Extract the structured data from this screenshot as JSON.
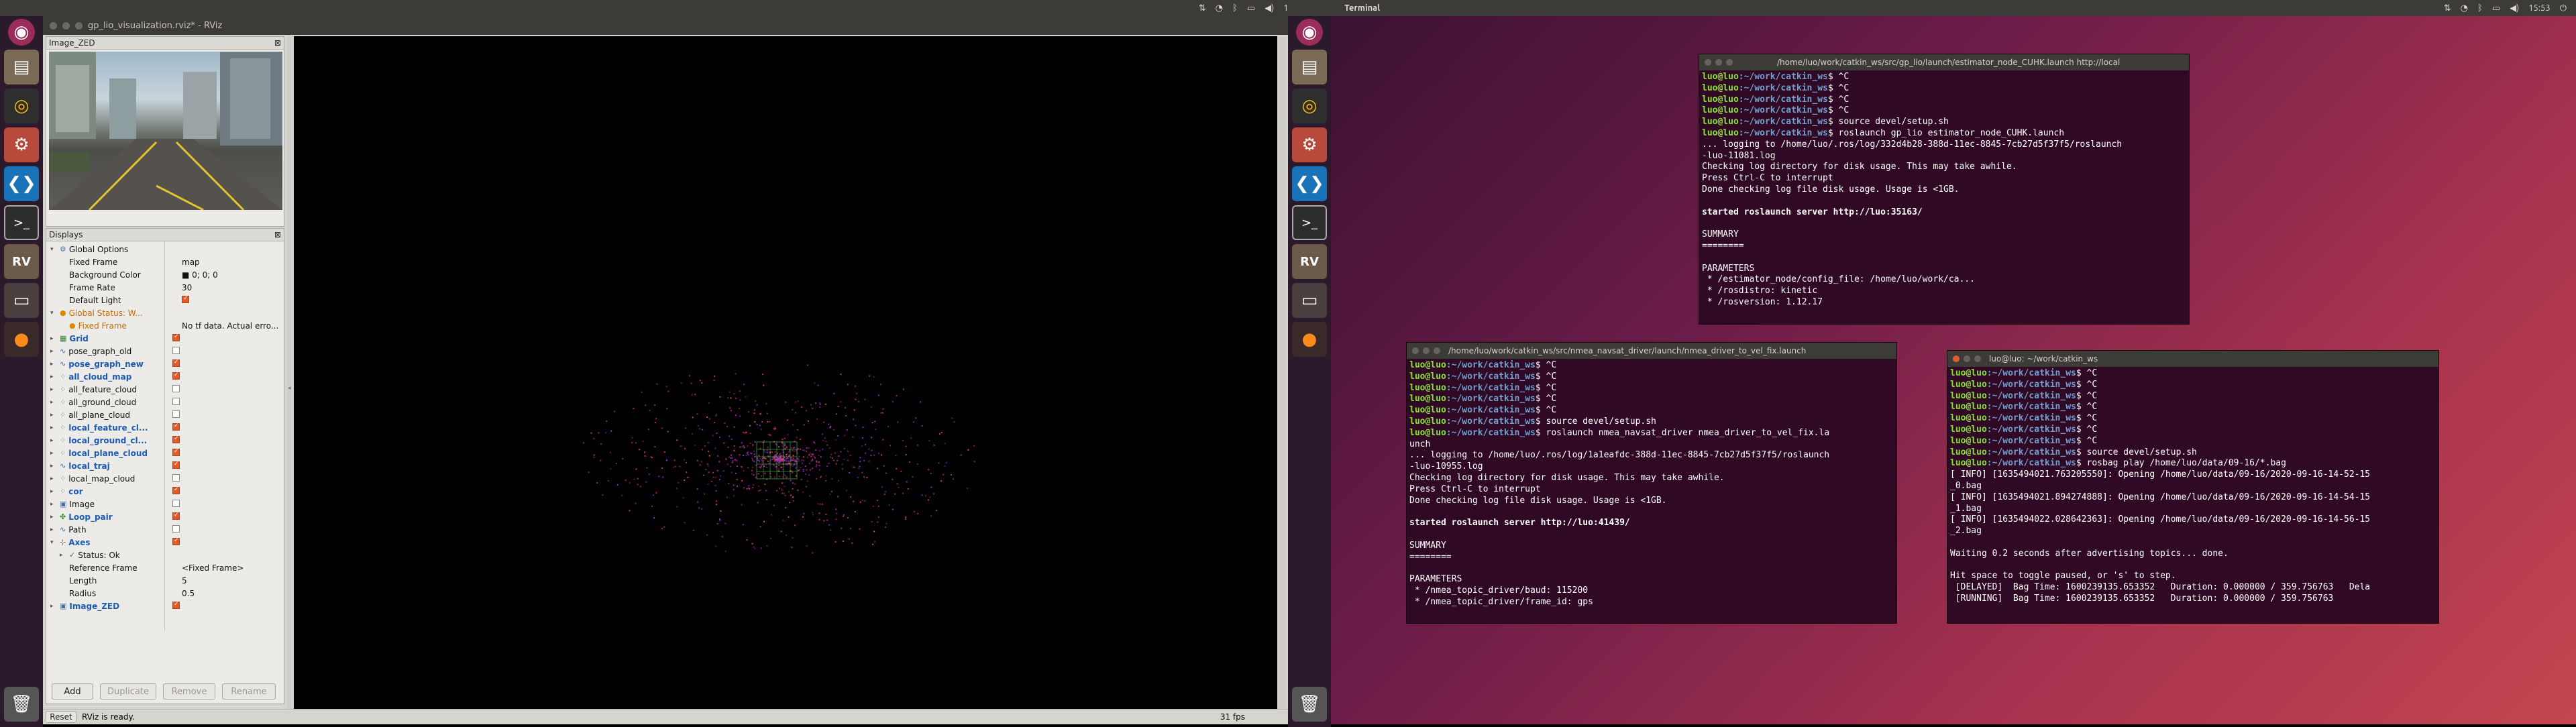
{
  "top_left": {
    "app_title": "",
    "clock": "15:53",
    "battery": "⚡",
    "tray_icons": [
      "sort-icon",
      "wifi-icon",
      "bluetooth-icon",
      "battery-icon",
      "volume-icon"
    ]
  },
  "top_right": {
    "app_title": "Terminal",
    "clock": "15:53"
  },
  "rviz": {
    "window_title": "gp_lio_visualization.rviz* - RViz",
    "image_panel_title": "Image_ZED",
    "displays_title": "Displays",
    "rows": [
      {
        "indent": 0,
        "tri": "▾",
        "icon": "gear",
        "label": "Global Options",
        "style": "",
        "value": "",
        "cb": ""
      },
      {
        "indent": 1,
        "tri": "",
        "icon": "",
        "label": "Fixed Frame",
        "style": "",
        "value": "map",
        "cb": ""
      },
      {
        "indent": 1,
        "tri": "",
        "icon": "",
        "label": "Background Color",
        "style": "",
        "value": "■ 0; 0; 0",
        "cb": ""
      },
      {
        "indent": 1,
        "tri": "",
        "icon": "",
        "label": "Frame Rate",
        "style": "",
        "value": "30",
        "cb": ""
      },
      {
        "indent": 1,
        "tri": "",
        "icon": "",
        "label": "Default Light",
        "style": "",
        "value": "",
        "cb": "on"
      },
      {
        "indent": 0,
        "tri": "▾",
        "icon": "warn",
        "label": "Global Status: W...",
        "style": "orange",
        "value": "",
        "cb": ""
      },
      {
        "indent": 1,
        "tri": "",
        "icon": "warn",
        "label": "Fixed Frame",
        "style": "orange",
        "value": "No tf data.  Actual erro...",
        "cb": ""
      },
      {
        "indent": 0,
        "tri": "▸",
        "icon": "grid",
        "label": "Grid",
        "style": "blue",
        "value": "",
        "cb": "on"
      },
      {
        "indent": 0,
        "tri": "▸",
        "icon": "path",
        "label": "pose_graph_old",
        "style": "",
        "value": "",
        "cb": "off"
      },
      {
        "indent": 0,
        "tri": "▸",
        "icon": "path",
        "label": "pose_graph_new",
        "style": "blue",
        "value": "",
        "cb": "on"
      },
      {
        "indent": 0,
        "tri": "▸",
        "icon": "cloud",
        "label": "all_cloud_map",
        "style": "blue",
        "value": "",
        "cb": "on"
      },
      {
        "indent": 0,
        "tri": "▸",
        "icon": "cloud",
        "label": "all_feature_cloud",
        "style": "",
        "value": "",
        "cb": "off"
      },
      {
        "indent": 0,
        "tri": "▸",
        "icon": "cloud",
        "label": "all_ground_cloud",
        "style": "",
        "value": "",
        "cb": "off"
      },
      {
        "indent": 0,
        "tri": "▸",
        "icon": "cloud",
        "label": "all_plane_cloud",
        "style": "",
        "value": "",
        "cb": "off"
      },
      {
        "indent": 0,
        "tri": "▸",
        "icon": "cloud",
        "label": "local_feature_cl...",
        "style": "blue",
        "value": "",
        "cb": "on"
      },
      {
        "indent": 0,
        "tri": "▸",
        "icon": "cloud",
        "label": "local_ground_cl...",
        "style": "blue",
        "value": "",
        "cb": "on"
      },
      {
        "indent": 0,
        "tri": "▸",
        "icon": "cloud",
        "label": "local_plane_cloud",
        "style": "blue",
        "value": "",
        "cb": "on"
      },
      {
        "indent": 0,
        "tri": "▸",
        "icon": "path",
        "label": "local_traj",
        "style": "blue",
        "value": "",
        "cb": "on"
      },
      {
        "indent": 0,
        "tri": "▸",
        "icon": "cloud",
        "label": "local_map_cloud",
        "style": "",
        "value": "",
        "cb": "off"
      },
      {
        "indent": 0,
        "tri": "▸",
        "icon": "cloud",
        "label": "cor",
        "style": "blue",
        "value": "",
        "cb": "on"
      },
      {
        "indent": 0,
        "tri": "▸",
        "icon": "image",
        "label": "Image",
        "style": "",
        "value": "",
        "cb": "off"
      },
      {
        "indent": 0,
        "tri": "▸",
        "icon": "marker",
        "label": "Loop_pair",
        "style": "blue",
        "value": "",
        "cb": "on"
      },
      {
        "indent": 0,
        "tri": "▸",
        "icon": "path",
        "label": "Path",
        "style": "",
        "value": "",
        "cb": "off"
      },
      {
        "indent": 0,
        "tri": "▾",
        "icon": "axes",
        "label": "Axes",
        "style": "blue",
        "value": "",
        "cb": "on"
      },
      {
        "indent": 1,
        "tri": "▸",
        "icon": "ok",
        "label": "Status: Ok",
        "style": "",
        "value": "",
        "cb": ""
      },
      {
        "indent": 1,
        "tri": "",
        "icon": "",
        "label": "Reference Frame",
        "style": "",
        "value": "<Fixed Frame>",
        "cb": ""
      },
      {
        "indent": 1,
        "tri": "",
        "icon": "",
        "label": "Length",
        "style": "",
        "value": "5",
        "cb": ""
      },
      {
        "indent": 1,
        "tri": "",
        "icon": "",
        "label": "Radius",
        "style": "",
        "value": "0.5",
        "cb": ""
      },
      {
        "indent": 0,
        "tri": "▸",
        "icon": "image",
        "label": "Image_ZED",
        "style": "blue",
        "value": "",
        "cb": "on"
      }
    ],
    "buttons": {
      "add": "Add",
      "duplicate": "Duplicate",
      "remove": "Remove",
      "rename": "Rename"
    },
    "status": {
      "reset": "Reset",
      "message": "RViz is ready.",
      "fps": "31 fps"
    }
  },
  "terminals": {
    "t1": {
      "title": "/home/luo/work/catkin_ws/src/gp_lio/launch/estimator_node_CUHK.launch http://local",
      "lines": [
        {
          "p": "luo@luo",
          "d": ":~/work/catkin_ws",
          "t": "$ ^C"
        },
        {
          "p": "luo@luo",
          "d": ":~/work/catkin_ws",
          "t": "$ ^C"
        },
        {
          "p": "luo@luo",
          "d": ":~/work/catkin_ws",
          "t": "$ ^C"
        },
        {
          "p": "luo@luo",
          "d": ":~/work/catkin_ws",
          "t": "$ ^C"
        },
        {
          "p": "luo@luo",
          "d": ":~/work/catkin_ws",
          "t": "$ source devel/setup.sh"
        },
        {
          "p": "luo@luo",
          "d": ":~/work/catkin_ws",
          "t": "$ roslaunch gp_lio estimator_node_CUHK.launch"
        },
        {
          "t": "... logging to /home/luo/.ros/log/332d4b28-388d-11ec-8845-7cb27d5f37f5/roslaunch"
        },
        {
          "t": "-luo-11081.log"
        },
        {
          "t": "Checking log directory for disk usage. This may take awhile."
        },
        {
          "t": "Press Ctrl-C to interrupt"
        },
        {
          "t": "Done checking log file disk usage. Usage is <1GB."
        },
        {
          "t": ""
        },
        {
          "t": "started roslaunch server http://luo:35163/",
          "b": true
        },
        {
          "t": ""
        },
        {
          "t": "SUMMARY"
        },
        {
          "t": "========"
        },
        {
          "t": ""
        },
        {
          "t": "PARAMETERS"
        },
        {
          "t": " * /estimator_node/config_file: /home/luo/work/ca..."
        },
        {
          "t": " * /rosdistro: kinetic"
        },
        {
          "t": " * /rosversion: 1.12.17"
        }
      ]
    },
    "t2": {
      "title": "/home/luo/work/catkin_ws/src/nmea_navsat_driver/launch/nmea_driver_to_vel_fix.launch",
      "lines": [
        {
          "p": "luo@luo",
          "d": ":~/work/catkin_ws",
          "t": "$ ^C"
        },
        {
          "p": "luo@luo",
          "d": ":~/work/catkin_ws",
          "t": "$ ^C"
        },
        {
          "p": "luo@luo",
          "d": ":~/work/catkin_ws",
          "t": "$ ^C"
        },
        {
          "p": "luo@luo",
          "d": ":~/work/catkin_ws",
          "t": "$ ^C"
        },
        {
          "p": "luo@luo",
          "d": ":~/work/catkin_ws",
          "t": "$ ^C"
        },
        {
          "p": "luo@luo",
          "d": ":~/work/catkin_ws",
          "t": "$ source devel/setup.sh"
        },
        {
          "p": "luo@luo",
          "d": ":~/work/catkin_ws",
          "t": "$ roslaunch nmea_navsat_driver nmea_driver_to_vel_fix.la"
        },
        {
          "t": "unch"
        },
        {
          "t": "... logging to /home/luo/.ros/log/1a1eafdc-388d-11ec-8845-7cb27d5f37f5/roslaunch"
        },
        {
          "t": "-luo-10955.log"
        },
        {
          "t": "Checking log directory for disk usage. This may take awhile."
        },
        {
          "t": "Press Ctrl-C to interrupt"
        },
        {
          "t": "Done checking log file disk usage. Usage is <1GB."
        },
        {
          "t": ""
        },
        {
          "t": "started roslaunch server http://luo:41439/",
          "b": true
        },
        {
          "t": ""
        },
        {
          "t": "SUMMARY"
        },
        {
          "t": "========"
        },
        {
          "t": ""
        },
        {
          "t": "PARAMETERS"
        },
        {
          "t": " * /nmea_topic_driver/baud: 115200"
        },
        {
          "t": " * /nmea_topic_driver/frame_id: gps"
        }
      ]
    },
    "t3": {
      "title": "luo@luo: ~/work/catkin_ws",
      "lines": [
        {
          "p": "luo@luo",
          "d": ":~/work/catkin_ws",
          "t": "$ ^C"
        },
        {
          "p": "luo@luo",
          "d": ":~/work/catkin_ws",
          "t": "$ ^C"
        },
        {
          "p": "luo@luo",
          "d": ":~/work/catkin_ws",
          "t": "$ ^C"
        },
        {
          "p": "luo@luo",
          "d": ":~/work/catkin_ws",
          "t": "$ ^C"
        },
        {
          "p": "luo@luo",
          "d": ":~/work/catkin_ws",
          "t": "$ ^C"
        },
        {
          "p": "luo@luo",
          "d": ":~/work/catkin_ws",
          "t": "$ ^C"
        },
        {
          "p": "luo@luo",
          "d": ":~/work/catkin_ws",
          "t": "$ ^C"
        },
        {
          "p": "luo@luo",
          "d": ":~/work/catkin_ws",
          "t": "$ source devel/setup.sh"
        },
        {
          "p": "luo@luo",
          "d": ":~/work/catkin_ws",
          "t": "$ rosbag play /home/luo/data/09-16/*.bag"
        },
        {
          "t": "[ INFO] [1635494021.763205550]: Opening /home/luo/data/09-16/2020-09-16-14-52-15"
        },
        {
          "t": "_0.bag"
        },
        {
          "t": "[ INFO] [1635494021.894274888]: Opening /home/luo/data/09-16/2020-09-16-14-54-15"
        },
        {
          "t": "_1.bag"
        },
        {
          "t": "[ INFO] [1635494022.028642363]: Opening /home/luo/data/09-16/2020-09-16-14-56-15"
        },
        {
          "t": "_2.bag"
        },
        {
          "t": ""
        },
        {
          "t": "Waiting 0.2 seconds after advertising topics... done."
        },
        {
          "t": ""
        },
        {
          "t": "Hit space to toggle paused, or 's' to step."
        },
        {
          "t": " [DELAYED]  Bag Time: 1600239135.653352   Duration: 0.000000 / 359.756763   Dela"
        },
        {
          "t": " [RUNNING]  Bag Time: 1600239135.653352   Duration: 0.000000 / 359.756763"
        }
      ]
    }
  }
}
